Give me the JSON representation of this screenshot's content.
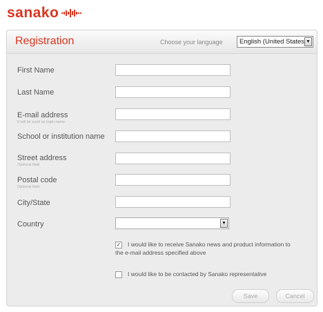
{
  "brand": {
    "logo_text": "sanako"
  },
  "header": {
    "title": "Registration",
    "language_label": "Choose your language",
    "language_value": "English (United States)"
  },
  "form": {
    "first_name": {
      "label": "First Name",
      "value": ""
    },
    "last_name": {
      "label": "Last Name",
      "value": ""
    },
    "email": {
      "label": "E-mail address",
      "hint": "It will be used as login name",
      "value": ""
    },
    "school": {
      "label": "School or institution name",
      "value": ""
    },
    "street": {
      "label": "Street address",
      "hint": "Optional field",
      "value": ""
    },
    "postal": {
      "label": "Postal code",
      "hint": "Optional field",
      "value": ""
    },
    "city": {
      "label": "City/State",
      "value": ""
    },
    "country": {
      "label": "Country",
      "value": ""
    }
  },
  "options": {
    "news_line1": "I would like to receive Sanako news and product information to",
    "news_line2": "the e-mail address specified above",
    "news_checked": true,
    "contact_text": "I would like to be contacted by Sanako representative",
    "contact_checked": false
  },
  "buttons": {
    "save": "Save",
    "cancel": "Cancel"
  },
  "colors": {
    "brand": "#d8351f",
    "panel": "#ececec"
  }
}
